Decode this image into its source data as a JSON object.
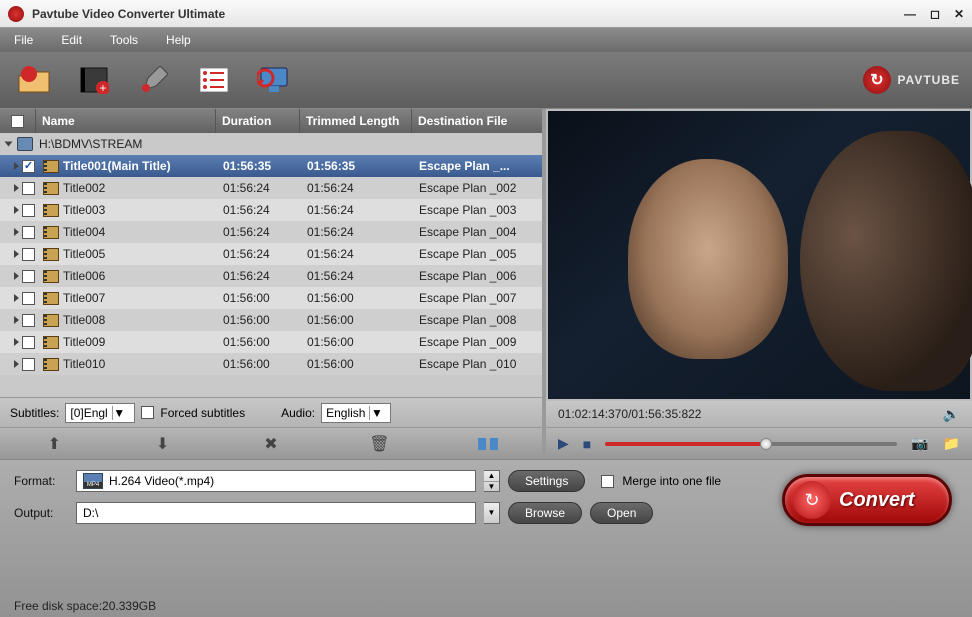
{
  "window": {
    "title": "Pavtube Video Converter Ultimate"
  },
  "menu": {
    "file": "File",
    "edit": "Edit",
    "tools": "Tools",
    "help": "Help"
  },
  "brand": {
    "name": "PAVTUBE"
  },
  "table": {
    "headers": {
      "name": "Name",
      "duration": "Duration",
      "trimmed": "Trimmed Length",
      "dest": "Destination File"
    },
    "source": "H:\\BDMV\\STREAM",
    "rows": [
      {
        "name": "Title001(Main Title)",
        "duration": "01:56:35",
        "trimmed": "01:56:35",
        "dest": "Escape Plan _...",
        "checked": true,
        "selected": true
      },
      {
        "name": "Title002",
        "duration": "01:56:24",
        "trimmed": "01:56:24",
        "dest": "Escape Plan _002",
        "checked": false,
        "selected": false
      },
      {
        "name": "Title003",
        "duration": "01:56:24",
        "trimmed": "01:56:24",
        "dest": "Escape Plan _003",
        "checked": false,
        "selected": false
      },
      {
        "name": "Title004",
        "duration": "01:56:24",
        "trimmed": "01:56:24",
        "dest": "Escape Plan _004",
        "checked": false,
        "selected": false
      },
      {
        "name": "Title005",
        "duration": "01:56:24",
        "trimmed": "01:56:24",
        "dest": "Escape Plan _005",
        "checked": false,
        "selected": false
      },
      {
        "name": "Title006",
        "duration": "01:56:24",
        "trimmed": "01:56:24",
        "dest": "Escape Plan _006",
        "checked": false,
        "selected": false
      },
      {
        "name": "Title007",
        "duration": "01:56:00",
        "trimmed": "01:56:00",
        "dest": "Escape Plan _007",
        "checked": false,
        "selected": false
      },
      {
        "name": "Title008",
        "duration": "01:56:00",
        "trimmed": "01:56:00",
        "dest": "Escape Plan _008",
        "checked": false,
        "selected": false
      },
      {
        "name": "Title009",
        "duration": "01:56:00",
        "trimmed": "01:56:00",
        "dest": "Escape Plan _009",
        "checked": false,
        "selected": false
      },
      {
        "name": "Title010",
        "duration": "01:56:00",
        "trimmed": "01:56:00",
        "dest": "Escape Plan _010",
        "checked": false,
        "selected": false
      }
    ]
  },
  "options": {
    "subtitles_label": "Subtitles:",
    "subtitles_value": "[0]Engl",
    "forced_label": "Forced subtitles",
    "audio_label": "Audio:",
    "audio_value": "English"
  },
  "preview": {
    "time": "01:02:14:370/01:56:35:822"
  },
  "bottom": {
    "format_label": "Format:",
    "format_value": "H.264 Video(*.mp4)",
    "settings_label": "Settings",
    "merge_label": "Merge into one file",
    "output_label": "Output:",
    "output_value": "D:\\",
    "browse_label": "Browse",
    "open_label": "Open",
    "convert_label": "Convert",
    "free_space": "Free disk space:20.339GB"
  }
}
